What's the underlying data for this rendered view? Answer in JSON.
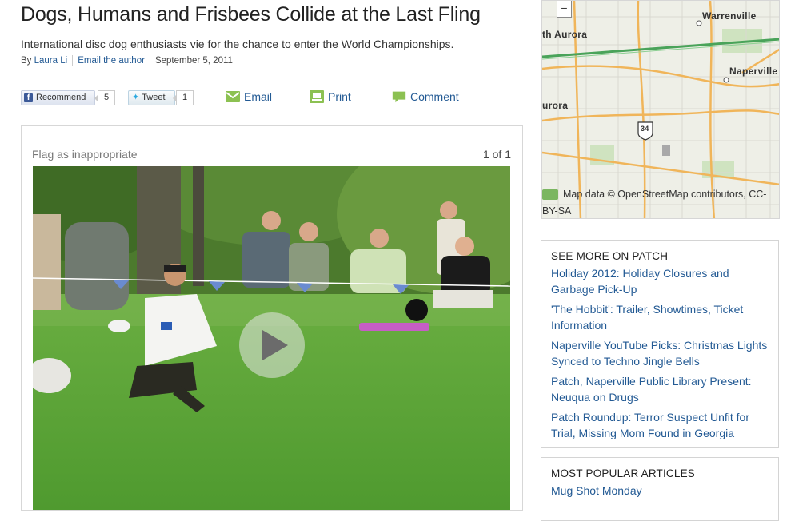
{
  "article": {
    "title": "Dogs, Humans and Frisbees Collide at the Last Fling",
    "subtitle": "International disc dog enthusiasts vie for the chance to enter the World Championships.",
    "byline": {
      "by_prefix": "By",
      "author": "Laura Li",
      "email_author": "Email the author",
      "date": "September 5, 2011"
    }
  },
  "share": {
    "facebook": {
      "label": "Recommend",
      "count": "5",
      "icon": "facebook-icon"
    },
    "twitter": {
      "label": "Tweet",
      "count": "1",
      "icon": "twitter-bird-icon"
    },
    "email": "Email",
    "print": "Print",
    "comment": "Comment",
    "icon_color": "#7ab648"
  },
  "gallery": {
    "flag": "Flag as inappropriate",
    "counter": "1 of 1",
    "play_icon": "play-icon"
  },
  "map": {
    "labels": {
      "warrenville": "Warrenville",
      "north_aurora": "th Aurora",
      "naperville": "Naperville",
      "aurora": "urora",
      "route_shield": "34"
    },
    "zoom_out": "−",
    "attribution": "Map data © OpenStreetMap contributors, CC-BY-SA"
  },
  "see_more": {
    "title": "SEE MORE ON PATCH",
    "links": [
      "Holiday 2012: Holiday Closures and Garbage Pick-Up",
      "'The Hobbit': Trailer, Showtimes, Ticket Information",
      "Naperville YouTube Picks: Christmas Lights Synced to Techno Jingle Bells",
      "Patch, Naperville Public Library Present: Neuqua on Drugs",
      "Patch Roundup: Terror Suspect Unfit for Trial, Missing Mom Found in Georgia"
    ]
  },
  "most_popular": {
    "title": "MOST POPULAR ARTICLES",
    "links": [
      "Mug Shot Monday"
    ]
  },
  "colors": {
    "link": "#235a94",
    "map_roads_orange": "#f0b55a",
    "map_highway_green": "#4aa35a"
  }
}
